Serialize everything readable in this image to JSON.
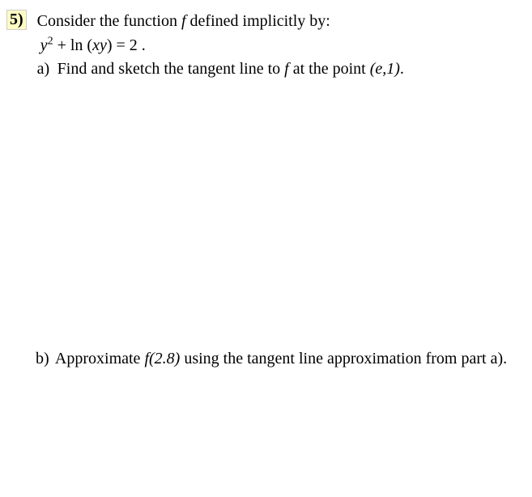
{
  "problem": {
    "number": "5)",
    "prompt": "Consider the function",
    "prompt_var": " f ",
    "prompt_rest": "defined implicitly  by:",
    "equation_y": "y",
    "equation_exp": "2",
    "equation_mid": " + ln (",
    "equation_xy": "xy",
    "equation_end": ") = 2  .",
    "part_a": {
      "label": "a)",
      "text1": "Find and sketch the tangent line to ",
      "text_f": "f",
      "text2": " at the point ",
      "point": "(e,1)",
      "period": "."
    },
    "part_b": {
      "label": "b)",
      "text1": "Approximate  ",
      "text_f": "f(2.8)",
      "text2": " using the tangent line approximation from part a)."
    }
  }
}
